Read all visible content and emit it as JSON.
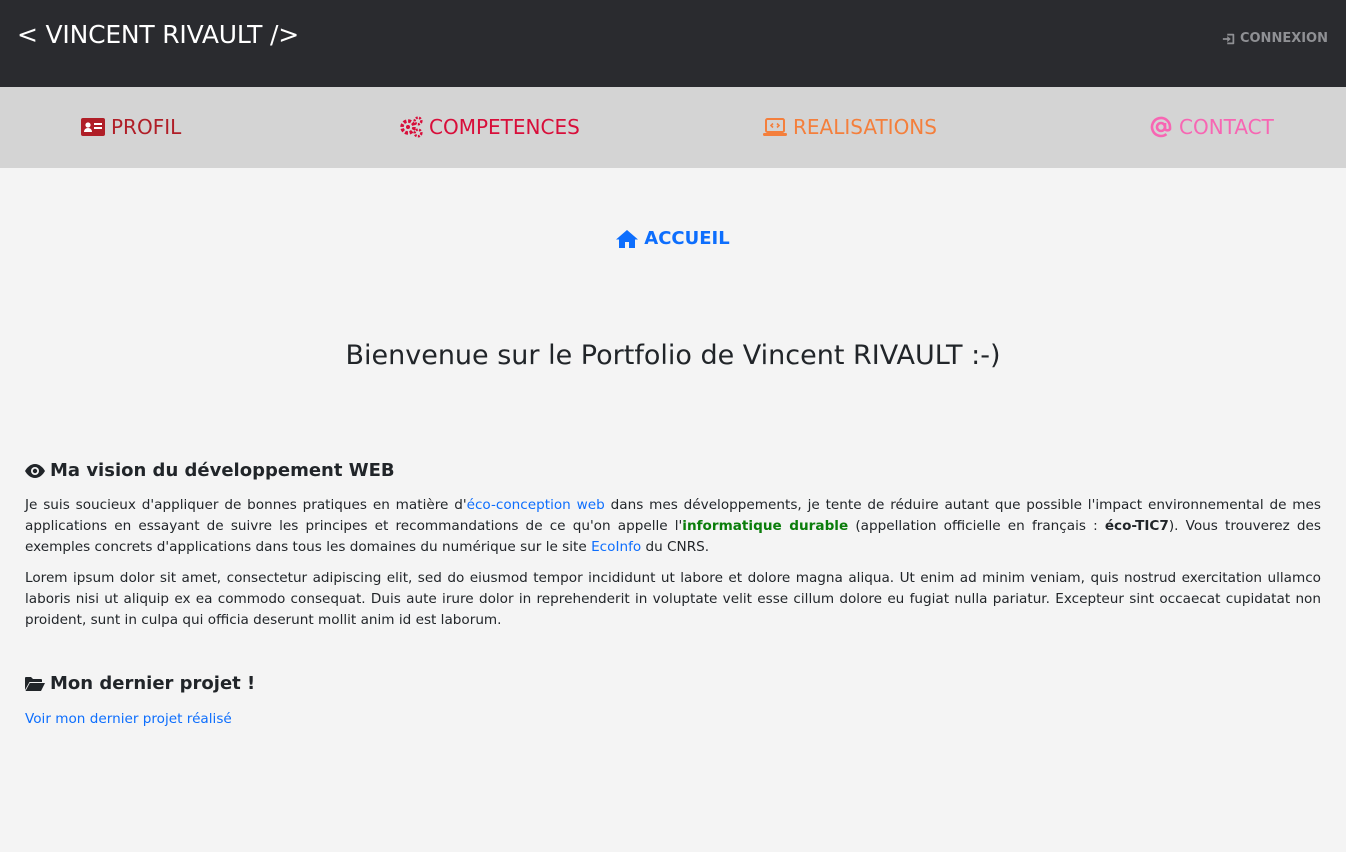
{
  "header": {
    "brand": "< VINCENT RIVAULT />",
    "login_label": "CONNEXION"
  },
  "nav": {
    "items": [
      {
        "label": "PROFIL",
        "icon": "id-card-icon",
        "color": "#b01e27"
      },
      {
        "label": "COMPETENCES",
        "icon": "gears-icon",
        "color": "#d80e3a"
      },
      {
        "label": "REALISATIONS",
        "icon": "laptop-code-icon",
        "color": "#f47f3c"
      },
      {
        "label": "CONTACT",
        "icon": "at-icon",
        "color": "#f766b3"
      }
    ]
  },
  "breadcrumb": {
    "label": "ACCUEIL",
    "icon": "home-icon",
    "color": "#0d6efd"
  },
  "main": {
    "title": "Bienvenue sur le Portfolio de Vincent RIVAULT :-)",
    "vision": {
      "heading": "Ma vision du développement WEB",
      "icon": "eye-icon",
      "p1": {
        "t1": "Je suis soucieux d'appliquer de bonnes pratiques en matière d'",
        "link1": "éco-conception web",
        "t2": " dans mes développements, je tente de réduire autant que possible l'impact environnemental de mes applications en essayant de suivre les principes et recommandations de ce qu'on appelle l'",
        "highlight": "informatique durable",
        "t3": " (appellation officielle en français : ",
        "strong": "éco-TIC7",
        "t4": "). Vous trouverez des exemples concrets d'applications dans tous les domaines du numérique sur le site ",
        "link2": "EcoInfo",
        "t5": " du CNRS."
      },
      "p2": "Lorem ipsum dolor sit amet, consectetur adipiscing elit, sed do eiusmod tempor incididunt ut labore et dolore magna aliqua. Ut enim ad minim veniam, quis nostrud exercitation ullamco laboris nisi ut aliquip ex ea commodo consequat. Duis aute irure dolor in reprehenderit in voluptate velit esse cillum dolore eu fugiat nulla pariatur. Excepteur sint occaecat cupidatat non proident, sunt in culpa qui officia deserunt mollit anim id est laborum."
    },
    "project": {
      "heading": "Mon dernier projet !",
      "icon": "folder-open-icon",
      "link": "Voir mon dernier projet réalisé"
    }
  }
}
